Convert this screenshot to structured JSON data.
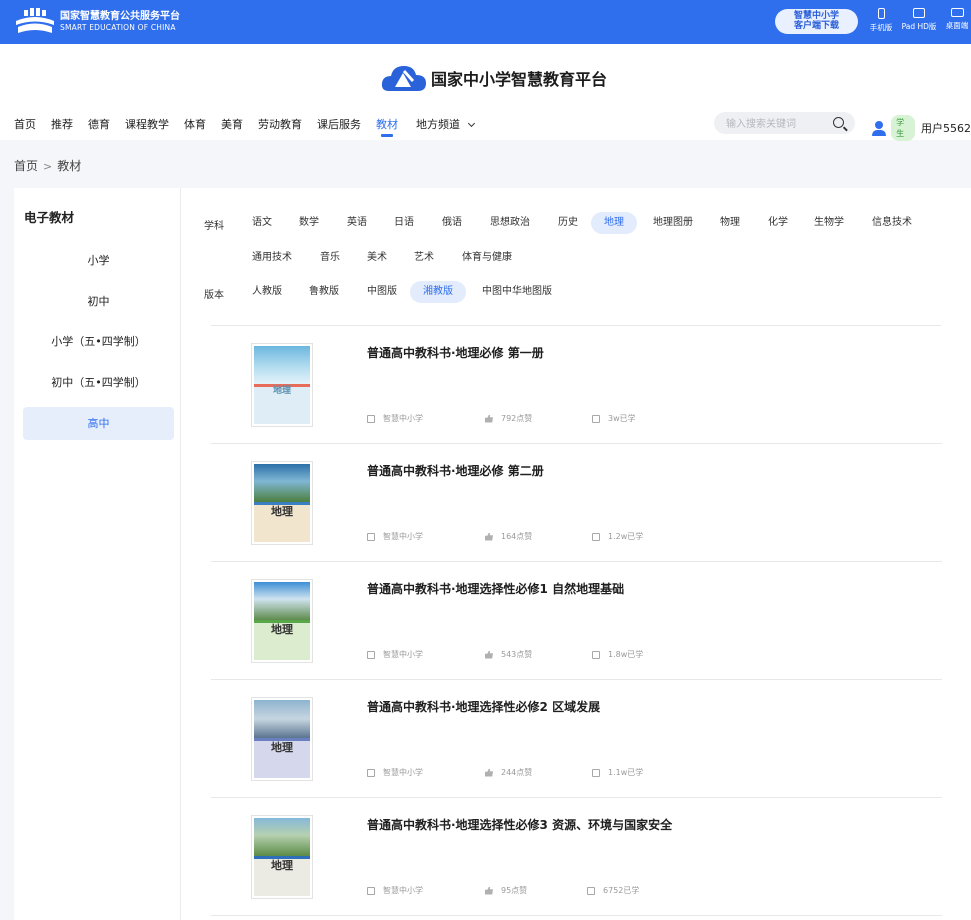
{
  "topbar": {
    "brand_cn": "国家智慧教育公共服务平台",
    "brand_en": "SMART EDUCATION OF CHINA",
    "download_line1": "智慧中小学",
    "download_line2": "客户端下载",
    "devices": [
      "手机版",
      "Pad HD版",
      "桌面端"
    ]
  },
  "header": {
    "logo_title": "国家中小学智慧教育平台",
    "nav": [
      "首页",
      "推荐",
      "德育",
      "课程教学",
      "体育",
      "美育",
      "劳动教育",
      "课后服务",
      "教材",
      "地方频道"
    ],
    "nav_active": "教材",
    "search_placeholder": "输入搜索关键词",
    "user_badge": "学生",
    "user_name": "用户5562"
  },
  "breadcrumb": {
    "home": "首页",
    "sep": ">",
    "current": "教材"
  },
  "sidebar": {
    "title": "电子教材",
    "items": [
      "小学",
      "初中",
      "小学（五•四学制）",
      "初中（五•四学制）",
      "高中"
    ],
    "active": "高中"
  },
  "filters": {
    "subject_label": "学科",
    "subjects_row1": [
      "语文",
      "数学",
      "英语",
      "日语",
      "俄语",
      "思想政治",
      "历史",
      "地理",
      "地理图册",
      "物理",
      "化学",
      "生物学",
      "信息技术"
    ],
    "subjects_row2": [
      "通用技术",
      "音乐",
      "美术",
      "艺术",
      "体育与健康"
    ],
    "subject_active": "地理",
    "version_label": "版本",
    "versions": [
      "人教版",
      "鲁教版",
      "中图版",
      "湘教版",
      "中图中华地图版"
    ],
    "version_active": "湘教版"
  },
  "books": [
    {
      "title": "普通高中教科书·地理必修 第一册",
      "publisher": "智慧中小学",
      "likes": "792点赞",
      "studied": "3w已学",
      "cover_title": "地理"
    },
    {
      "title": "普通高中教科书·地理必修 第二册",
      "publisher": "智慧中小学",
      "likes": "164点赞",
      "studied": "1.2w已学",
      "cover_title": "地理"
    },
    {
      "title": "普通高中教科书·地理选择性必修1 自然地理基础",
      "publisher": "智慧中小学",
      "likes": "543点赞",
      "studied": "1.8w已学",
      "cover_title": "地理"
    },
    {
      "title": "普通高中教科书·地理选择性必修2 区域发展",
      "publisher": "智慧中小学",
      "likes": "244点赞",
      "studied": "1.1w已学",
      "cover_title": "地理"
    },
    {
      "title": "普通高中教科书·地理选择性必修3 资源、环境与国家安全",
      "publisher": "智慧中小学",
      "likes": "95点赞",
      "studied": "6752已学",
      "cover_title": "地理"
    }
  ],
  "colors": {
    "primary": "#2f6eed",
    "active_bg": "#e3ecfc"
  }
}
